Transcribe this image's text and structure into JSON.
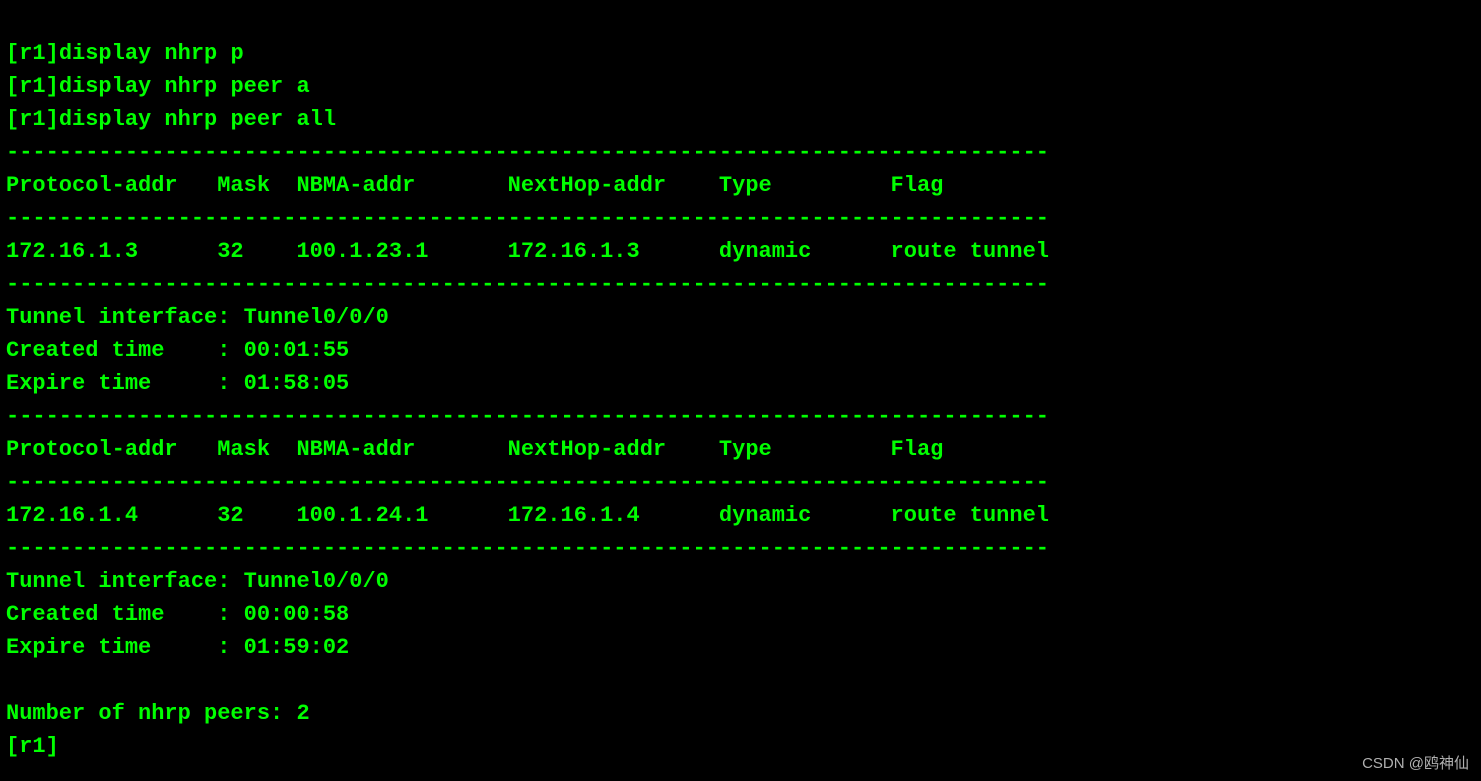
{
  "terminal": {
    "prompt_open": "[",
    "hostname": "r1",
    "prompt_close": "]",
    "commands": [
      "display nhrp p",
      "display nhrp peer a",
      "display nhrp peer all"
    ],
    "divider": "-------------------------------------------------------------------------------",
    "header_line": "Protocol-addr   Mask  NBMA-addr       NextHop-addr    Type         Flag",
    "entries": [
      {
        "row": "172.16.1.3      32    100.1.23.1      172.16.1.3      dynamic      route tunnel",
        "tunnel_interface_label": "Tunnel interface:",
        "tunnel_interface_value": "Tunnel0/0/0",
        "created_label": "Created time    :",
        "created_value": "00:01:55",
        "expire_label": "Expire time     :",
        "expire_value": "01:58:05"
      },
      {
        "row": "172.16.1.4      32    100.1.24.1      172.16.1.4      dynamic      route tunnel",
        "tunnel_interface_label": "Tunnel interface:",
        "tunnel_interface_value": "Tunnel0/0/0",
        "created_label": "Created time    :",
        "created_value": "00:00:58",
        "expire_label": "Expire time     :",
        "expire_value": "01:59:02"
      }
    ],
    "summary_label": "Number of nhrp peers:",
    "summary_value": "2",
    "final_prompt": "[r1]"
  },
  "watermark": "CSDN @鸥神仙"
}
